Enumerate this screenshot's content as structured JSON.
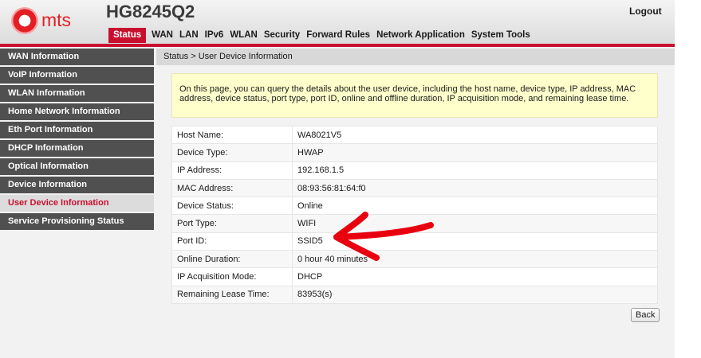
{
  "header": {
    "logo_text": "mts",
    "model": "HG8245Q2",
    "logout_label": "Logout"
  },
  "topnav": {
    "tabs": [
      {
        "label": "Status",
        "active": true
      },
      {
        "label": "WAN"
      },
      {
        "label": "LAN"
      },
      {
        "label": "IPv6"
      },
      {
        "label": "WLAN"
      },
      {
        "label": "Security"
      },
      {
        "label": "Forward Rules"
      },
      {
        "label": "Network Application"
      },
      {
        "label": "System Tools"
      }
    ]
  },
  "sidebar": {
    "items": [
      {
        "label": "WAN Information"
      },
      {
        "label": "VoIP Information"
      },
      {
        "label": "WLAN Information"
      },
      {
        "label": "Home Network Information"
      },
      {
        "label": "Eth Port Information"
      },
      {
        "label": "DHCP Information"
      },
      {
        "label": "Optical Information"
      },
      {
        "label": "Device Information"
      },
      {
        "label": "User Device Information",
        "active": true
      },
      {
        "label": "Service Provisioning Status"
      }
    ]
  },
  "main": {
    "breadcrumb": "Status > User Device Information",
    "description": "On this page, you can query the details about the user device, including the host name, device type, IP address, MAC address, device status, port type, port ID, online and offline duration, IP acquisition mode, and remaining lease time.",
    "rows": [
      {
        "label": "Host Name:",
        "value": "WA8021V5"
      },
      {
        "label": "Device Type:",
        "value": "HWAP"
      },
      {
        "label": "IP Address:",
        "value": "192.168.1.5"
      },
      {
        "label": "MAC Address:",
        "value": "08:93:56:81:64:f0"
      },
      {
        "label": "Device Status:",
        "value": "Online"
      },
      {
        "label": "Port Type:",
        "value": "WIFI"
      },
      {
        "label": "Port ID:",
        "value": "SSID5"
      },
      {
        "label": "Online Duration:",
        "value": "0 hour 40 minutes"
      },
      {
        "label": "IP Acquisition Mode:",
        "value": "DHCP"
      },
      {
        "label": "Remaining Lease Time:",
        "value": "83953(s)"
      }
    ],
    "back_label": "Back"
  },
  "colors": {
    "accent": "#c8102e",
    "sidebar_bg": "#505050",
    "note_bg": "#ffffcc",
    "annotation_arrow": "#e8000f"
  },
  "annotation": {
    "icon": "red-arrow-icon"
  }
}
